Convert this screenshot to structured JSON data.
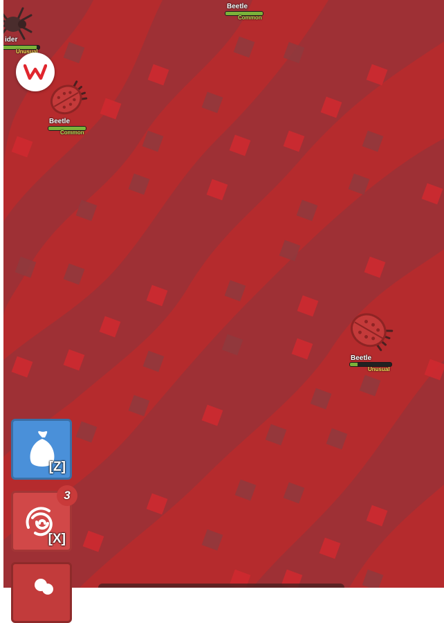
{
  "mobs": [
    {
      "name": "Beetle",
      "rarity": "Common",
      "rarity_color": "#b7e55a",
      "hp": 1.0
    },
    {
      "name": "Beetle",
      "rarity": "Common",
      "rarity_color": "#b7e55a",
      "hp": 1.0
    },
    {
      "name": "Beetle",
      "rarity": "Unusual",
      "rarity_color": "#ffe65d",
      "hp": 0.18
    },
    {
      "name": "Spider",
      "name_visible": "ider",
      "rarity": "Unusual",
      "rarity_color": "#ffe65d",
      "hp": 0.95
    }
  ],
  "slots": [
    {
      "icon": "bag-icon",
      "key": "[Z]",
      "color": "#4a90d9",
      "border": "#3a6fa6"
    },
    {
      "icon": "swirl-icon",
      "key": "[X]",
      "color": "#d14848",
      "border": "#a33636",
      "count": "3"
    },
    {
      "icon": "bubble-icon",
      "color": "#c23b3b",
      "border": "#8e2a2a"
    }
  ],
  "colors": {
    "field": "#b52b2d",
    "wave": "#9e2e33",
    "tile_light": "#c22a2e",
    "tile_dark": "#93393c"
  }
}
